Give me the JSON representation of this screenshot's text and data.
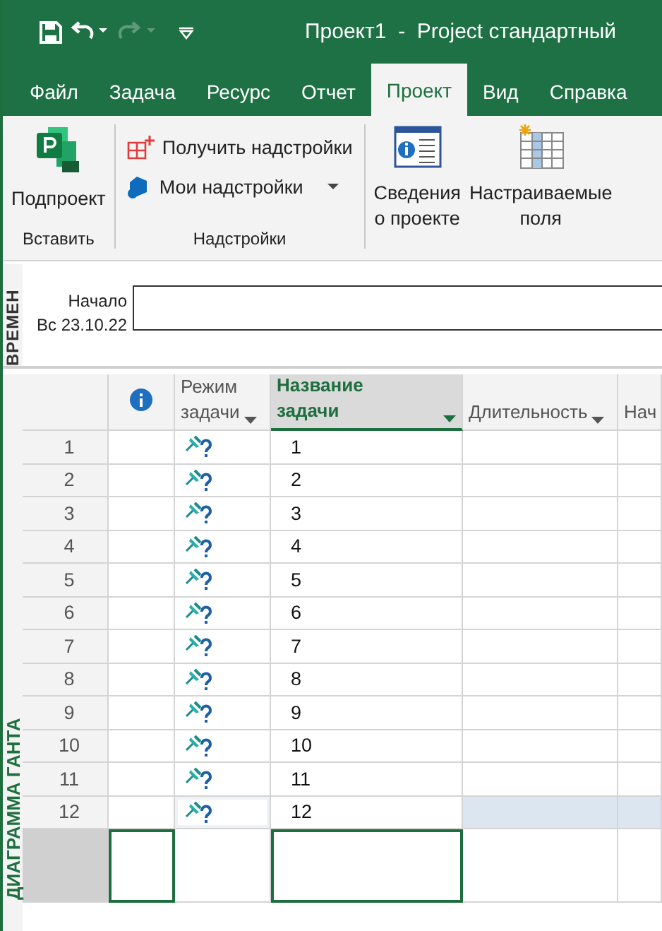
{
  "window": {
    "title": "Проект1  -  Project стандартный"
  },
  "quick_access": [
    {
      "kind": "save",
      "disabled": false
    },
    {
      "kind": "undo",
      "disabled": false
    },
    {
      "kind": "redo",
      "disabled": true
    },
    {
      "kind": "customize",
      "disabled": false
    }
  ],
  "tabs": [
    {
      "label": "Файл",
      "selected": false
    },
    {
      "label": "Задача",
      "selected": false
    },
    {
      "label": "Ресурс",
      "selected": false
    },
    {
      "label": "Отчет",
      "selected": false
    },
    {
      "label": "Проект",
      "selected": true
    },
    {
      "label": "Вид",
      "selected": false
    },
    {
      "label": "Справка",
      "selected": false
    }
  ],
  "ribbon": {
    "groups": [
      {
        "label": "Вставить",
        "commands": [
          {
            "kind": "large",
            "label": "Подпроект"
          }
        ]
      },
      {
        "label": "Надстройки",
        "commands": [
          {
            "kind": "small",
            "label": "Получить надстройки",
            "dropdown": false
          },
          {
            "kind": "small",
            "label": "Мои надстройки",
            "dropdown": true
          }
        ]
      },
      {
        "commands": [
          {
            "kind": "large",
            "label": "Сведения\nо проекте"
          },
          {
            "kind": "large",
            "label": "Настраиваемые\nполя"
          }
        ]
      }
    ]
  },
  "timeline": {
    "label": "ВРЕМЕН",
    "start_label": "Начало",
    "start_date": "Вс 23.10.22"
  },
  "gantt": {
    "side_label": "ДИАГРАММА ГАНТА",
    "columns": [
      {
        "kind": "indicator",
        "selected": false
      },
      {
        "kind": "text",
        "label": "Режим\nзадачи",
        "selected": false
      },
      {
        "kind": "text",
        "label": "Название\nзадачи",
        "selected": true
      },
      {
        "kind": "text",
        "label": "Длительность",
        "selected": false
      },
      {
        "kind": "text",
        "label": "Нач",
        "selected": false
      }
    ],
    "rows": [
      {
        "id": "1",
        "kind": "manual_task",
        "name": "1",
        "highlighted": false
      },
      {
        "id": "2",
        "kind": "manual_task",
        "name": "2",
        "highlighted": false
      },
      {
        "id": "3",
        "kind": "manual_task",
        "name": "3",
        "highlighted": false
      },
      {
        "id": "4",
        "kind": "manual_task",
        "name": "4",
        "highlighted": false
      },
      {
        "id": "5",
        "kind": "manual_task",
        "name": "5",
        "highlighted": false
      },
      {
        "id": "6",
        "kind": "manual_task",
        "name": "6",
        "highlighted": false
      },
      {
        "id": "7",
        "kind": "manual_task",
        "name": "7",
        "highlighted": false
      },
      {
        "id": "8",
        "kind": "manual_task",
        "name": "8",
        "highlighted": false
      },
      {
        "id": "9",
        "kind": "manual_task",
        "name": "9",
        "highlighted": false
      },
      {
        "id": "10",
        "kind": "manual_task",
        "name": "10",
        "highlighted": false
      },
      {
        "id": "11",
        "kind": "manual_task",
        "name": "11",
        "highlighted": false
      },
      {
        "id": "12",
        "kind": "manual_task",
        "name": "12",
        "highlighted": true
      }
    ],
    "blank_row_selected": true
  }
}
